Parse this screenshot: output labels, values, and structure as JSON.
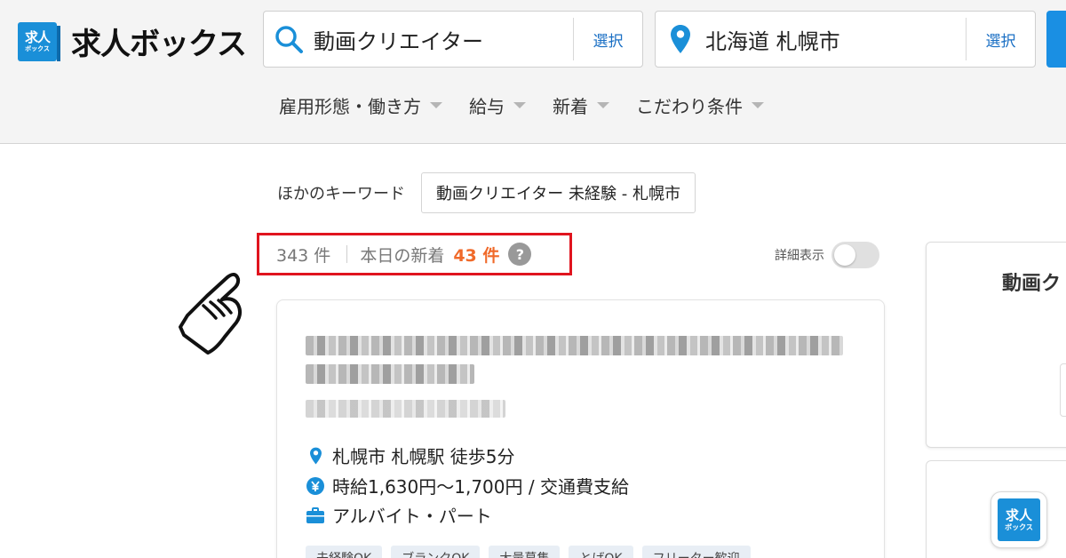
{
  "logo": {
    "mark_line1": "求人",
    "mark_line2": "ボックス",
    "text": "求人ボックス"
  },
  "search": {
    "keyword": {
      "value": "動画クリエイター",
      "select_label": "選択",
      "icon": "search-icon"
    },
    "location": {
      "value": "北海道 札幌市",
      "select_label": "選択",
      "icon": "location-pin-icon"
    }
  },
  "filters": [
    {
      "label": "雇用形態・働き方"
    },
    {
      "label": "給与"
    },
    {
      "label": "新着"
    },
    {
      "label": "こだわり条件"
    }
  ],
  "other_keywords": {
    "label": "ほかのキーワード",
    "chip": "動画クリエイター 未経験 - 札幌市"
  },
  "results": {
    "total": "343 件",
    "today_label": "本日の新着",
    "today_count": "43 件",
    "help": "?"
  },
  "detail_toggle": {
    "label": "詳細表示",
    "on": false
  },
  "job": {
    "location": "札幌市 札幌駅 徒歩5分",
    "salary": "時給1,630円〜1,700円 / 交通費支給",
    "type": "アルバイト・パート",
    "tags": [
      "未経験OK",
      "ブランクOK",
      "大量募集",
      "とげOK",
      "フリーター歓迎"
    ]
  },
  "side": {
    "title": "動画ク",
    "app_line1": "求人",
    "app_line2": "ボックス"
  },
  "colors": {
    "brand": "#1a8fd8",
    "highlight_border": "#e0141e",
    "new_count": "#f06a2a",
    "link": "#1a6fc4"
  }
}
